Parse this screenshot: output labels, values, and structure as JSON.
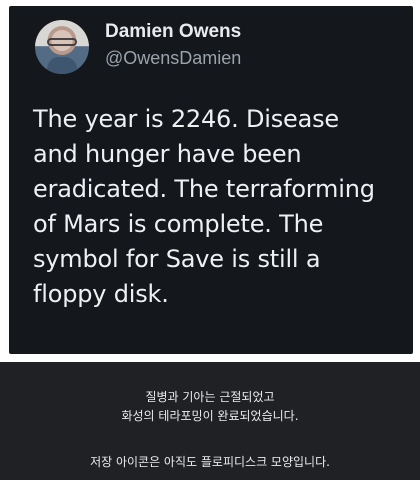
{
  "tweet": {
    "author": {
      "name": "Damien Owens",
      "handle": "@OwensDamien",
      "avatar_icon": "profile-photo"
    },
    "text_lines": [
      "The year is 2246. Disease",
      "and hunger have been",
      "eradicated. The terraforming",
      "of Mars is complete. The",
      "symbol for Save is still a",
      "floppy disk."
    ]
  },
  "caption": {
    "lines": [
      "질병과 기아는 근절되었고",
      "화성의 테라포밍이 완료되었습니다.",
      "저장 아이콘은 아직도 플로피디스크 모양입니다."
    ]
  },
  "colors": {
    "tweet_background": "#14171c",
    "primary_text": "#eef0f2",
    "secondary_text": "#9aa3ad",
    "caption_background": "#1f2125"
  }
}
